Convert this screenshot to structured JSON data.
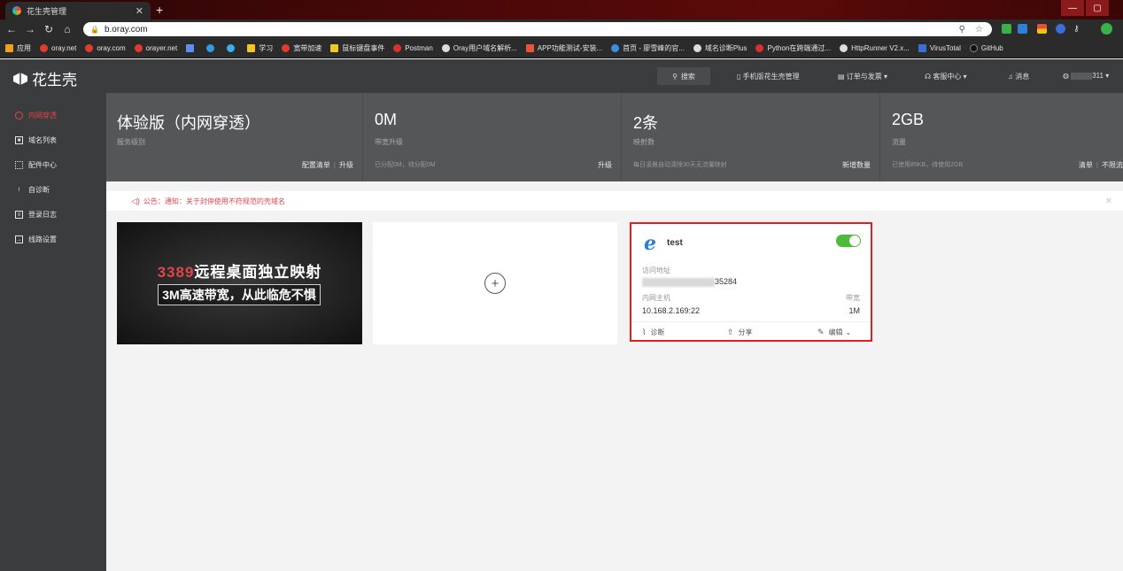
{
  "browser": {
    "tab_title": "花生壳管理",
    "url": "b.oray.com",
    "bookmarks": [
      "应用",
      "oray.net",
      "oray.com",
      "orayer.net",
      "学习",
      "宽带加速",
      "鼠标键盘事件",
      "Postman",
      "Oray用户域名解析...",
      "APP功能测试-安装...",
      "首页 - 廖雪峰的官...",
      "域名诊断Plus",
      "Python在跨端通过...",
      "HttpRunner V2.x...",
      "VirusTotal",
      "GitHub"
    ]
  },
  "header": {
    "logo": "花生壳",
    "search": "搜索",
    "mobile_manage": "手机版花生壳管理",
    "orders": "订单与发票",
    "service": "客服中心",
    "messages": "消息",
    "user_suffix": "311"
  },
  "sidebar": {
    "items": [
      {
        "label": "内网穿透"
      },
      {
        "label": "域名列表"
      },
      {
        "label": "配件中心"
      },
      {
        "label": "自诊断"
      },
      {
        "label": "登录日志"
      },
      {
        "label": "线路设置"
      }
    ]
  },
  "stats": [
    {
      "big": "体验版（内网穿透）",
      "sub": "服务级别",
      "hint": "",
      "act1": "配置清单",
      "act2": "升级"
    },
    {
      "big": "0M",
      "sub": "带宽升级",
      "hint": "已分配0M，待分配0M",
      "act1": "升级",
      "act2": ""
    },
    {
      "big": "2条",
      "sub": "映射数",
      "hint": "每日凌晨自动清除30天无流量映射",
      "act1": "新增数量",
      "act2": ""
    },
    {
      "big": "2GB",
      "sub": "流量",
      "hint": "已使用85KB，待使用2GB",
      "act1": "清单",
      "act2": "不限流"
    }
  ],
  "notice": {
    "text": "公告：通知：关于封停使用不符规范的壳域名"
  },
  "banner": {
    "number": "3389",
    "line1_rest": "远程桌面独立映射",
    "line2": "3M高速带宽，从此临危不惧"
  },
  "mapping": {
    "name": "test",
    "enabled": true,
    "access_label": "访问地址",
    "access_value_suffix": "35284",
    "host_label": "内网主机",
    "host_value": "10.168.2.169:22",
    "bandwidth_label": "带宽",
    "bandwidth_value": "1M",
    "diag": "诊断",
    "share": "分享",
    "edit": "编辑"
  }
}
